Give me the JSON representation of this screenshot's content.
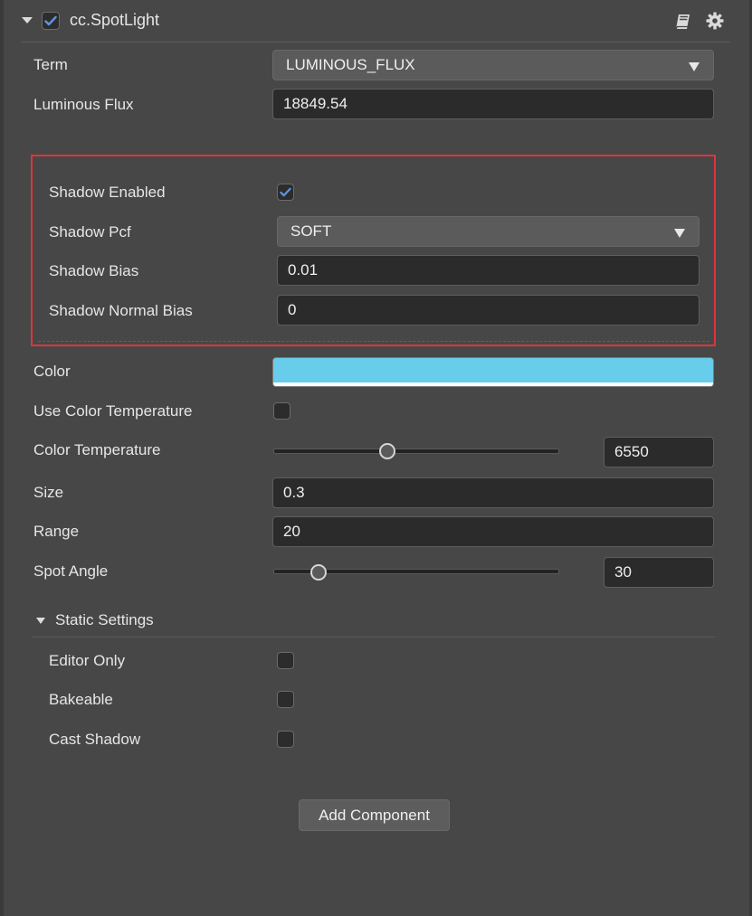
{
  "component": {
    "title": "cc.SpotLight",
    "enabled": true,
    "icons": [
      "book-icon",
      "gear-icon"
    ]
  },
  "term": {
    "label": "Term",
    "value": "LUMINOUS_FLUX"
  },
  "luminous_flux": {
    "label": "Luminous Flux",
    "value": "18849.54"
  },
  "shadow": {
    "enabled_label": "Shadow Enabled",
    "enabled": true,
    "pcf_label": "Shadow Pcf",
    "pcf_value": "SOFT",
    "bias_label": "Shadow Bias",
    "bias_value": "0.01",
    "normal_bias_label": "Shadow Normal Bias",
    "normal_bias_value": "0"
  },
  "color": {
    "label": "Color",
    "value": "#67cdea"
  },
  "use_color_temperature": {
    "label": "Use Color Temperature",
    "checked": false
  },
  "color_temperature": {
    "label": "Color Temperature",
    "value": "6550",
    "slider_fraction": 0.4
  },
  "size": {
    "label": "Size",
    "value": "0.3"
  },
  "range": {
    "label": "Range",
    "value": "20"
  },
  "spot_angle": {
    "label": "Spot Angle",
    "value": "30",
    "slider_fraction": 0.16
  },
  "static_settings": {
    "title": "Static Settings",
    "editor_only_label": "Editor Only",
    "editor_only": false,
    "bakeable_label": "Bakeable",
    "bakeable": false,
    "cast_shadow_label": "Cast Shadow",
    "cast_shadow": false
  },
  "add_component_label": "Add Component",
  "colors": {
    "highlight": "#e0343a",
    "accent": "#4a90e2",
    "color_value": "#67cdea"
  }
}
